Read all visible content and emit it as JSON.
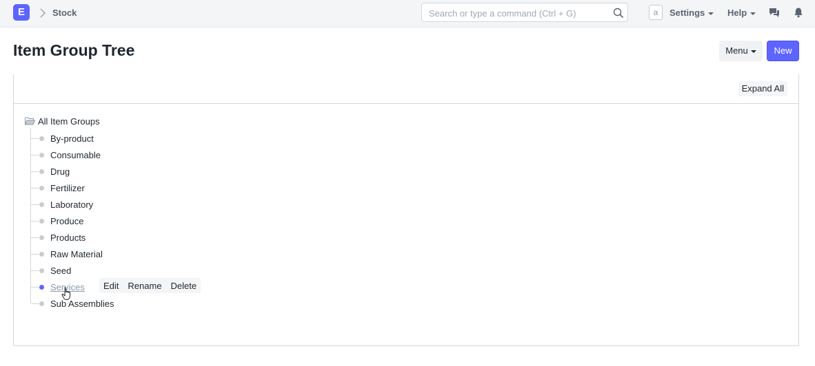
{
  "navbar": {
    "logo_letter": "E",
    "breadcrumb": "Stock",
    "search_placeholder": "Search or type a command (Ctrl + G)",
    "avatar_letter": "a",
    "settings_label": "Settings",
    "help_label": "Help"
  },
  "page": {
    "title": "Item Group Tree",
    "menu_label": "Menu",
    "new_label": "New"
  },
  "toolbar": {
    "expand_all_label": "Expand All"
  },
  "tree": {
    "root_label": "All Item Groups",
    "nodes": [
      {
        "label": "By-product"
      },
      {
        "label": "Consumable"
      },
      {
        "label": "Drug"
      },
      {
        "label": "Fertilizer"
      },
      {
        "label": "Laboratory"
      },
      {
        "label": "Produce"
      },
      {
        "label": "Products"
      },
      {
        "label": "Raw Material"
      },
      {
        "label": "Seed"
      },
      {
        "label": "Services"
      },
      {
        "label": "Sub Assemblies"
      }
    ],
    "active_node": "Services",
    "node_actions": [
      "Edit",
      "Rename",
      "Delete"
    ]
  },
  "colors": {
    "accent": "#5e64ff",
    "navbar_bg": "#f4f5f6",
    "text": "#1f272e"
  },
  "icons": [
    "app-logo",
    "chevron-right-icon",
    "search-icon",
    "caret-down-icon",
    "chat-icon",
    "bell-icon",
    "folder-open-icon",
    "hand-pointer-cursor"
  ]
}
